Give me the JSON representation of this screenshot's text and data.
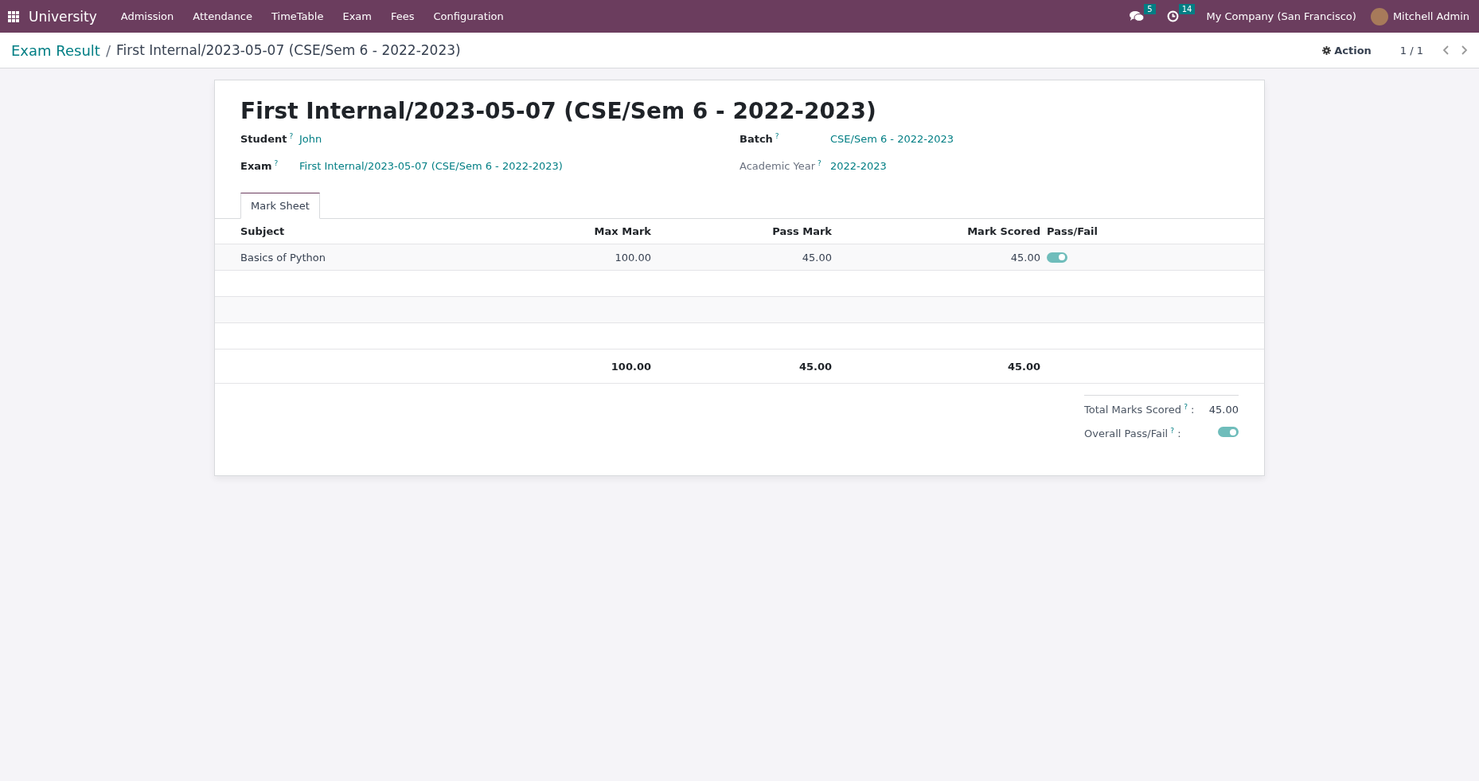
{
  "navbar": {
    "app_name": "University",
    "menu": [
      "Admission",
      "Attendance",
      "TimeTable",
      "Exam",
      "Fees",
      "Configuration"
    ],
    "messages_count": "5",
    "activities_count": "14",
    "company": "My Company (San Francisco)",
    "user": "Mitchell Admin"
  },
  "breadcrumb": {
    "parent": "Exam Result",
    "separator": "/",
    "current": "First Internal/2023-05-07 (CSE/Sem 6 - 2022-2023)"
  },
  "control_panel": {
    "action": "Action",
    "pager": "1 / 1"
  },
  "form": {
    "title": "First Internal/2023-05-07 (CSE/Sem 6 - 2022-2023)",
    "fields_left": [
      {
        "label": "Student",
        "help": "?",
        "value": "John",
        "readonly": false
      },
      {
        "label": "Exam",
        "help": "?",
        "value": "First Internal/2023-05-07 (CSE/Sem 6 - 2022-2023)",
        "readonly": false
      }
    ],
    "fields_right": [
      {
        "label": "Batch",
        "help": "?",
        "value": "CSE/Sem 6 - 2022-2023",
        "readonly": false
      },
      {
        "label": "Academic Year",
        "help": "?",
        "value": "2022-2023",
        "readonly": true
      }
    ],
    "tabs": [
      {
        "label": "Mark Sheet",
        "selected": true
      }
    ],
    "table": {
      "columns": [
        "Subject",
        "Max Mark",
        "Pass Mark",
        "Mark Scored",
        "Pass/Fail"
      ],
      "rows": [
        {
          "subject": "Basics of Python",
          "max_mark": "100.00",
          "pass_mark": "45.00",
          "mark_scored": "45.00",
          "pass": true
        }
      ],
      "totals": {
        "max_mark": "100.00",
        "pass_mark": "45.00",
        "mark_scored": "45.00"
      }
    },
    "summary": {
      "total_label": "Total Marks Scored",
      "total_help": "?",
      "total_colon": ":",
      "total_value": "45.00",
      "overall_label": "Overall Pass/Fail",
      "overall_help": "?",
      "overall_colon": ":",
      "overall_pass": true
    }
  }
}
